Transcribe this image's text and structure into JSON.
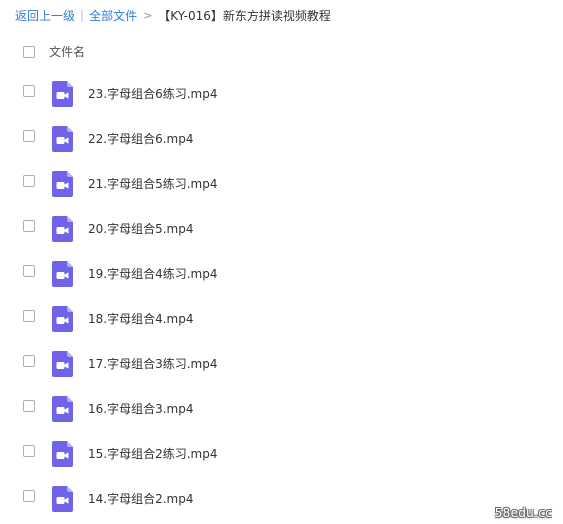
{
  "breadcrumb": {
    "back_label": "返回上一级",
    "separator": "|",
    "all_files_label": "全部文件",
    "arrow": ">",
    "current_folder": "【KY-016】新东方拼读视频教程"
  },
  "list_header": {
    "name_column": "文件名"
  },
  "files": [
    {
      "name": "23.字母组合6练习.mp4",
      "icon": "video-file-icon"
    },
    {
      "name": "22.字母组合6.mp4",
      "icon": "video-file-icon"
    },
    {
      "name": "21.字母组合5练习.mp4",
      "icon": "video-file-icon"
    },
    {
      "name": "20.字母组合5.mp4",
      "icon": "video-file-icon"
    },
    {
      "name": "19.字母组合4练习.mp4",
      "icon": "video-file-icon"
    },
    {
      "name": "18.字母组合4.mp4",
      "icon": "video-file-icon"
    },
    {
      "name": "17.字母组合3练习.mp4",
      "icon": "video-file-icon"
    },
    {
      "name": "16.字母组合3.mp4",
      "icon": "video-file-icon"
    },
    {
      "name": "15.字母组合2练习.mp4",
      "icon": "video-file-icon"
    },
    {
      "name": "14.字母组合2.mp4",
      "icon": "video-file-icon"
    }
  ],
  "watermark": "58edu.cc",
  "colors": {
    "link": "#2d7fd8",
    "icon_body": "#6f63e8",
    "icon_fold": "#b4adf4",
    "text": "#333333"
  }
}
